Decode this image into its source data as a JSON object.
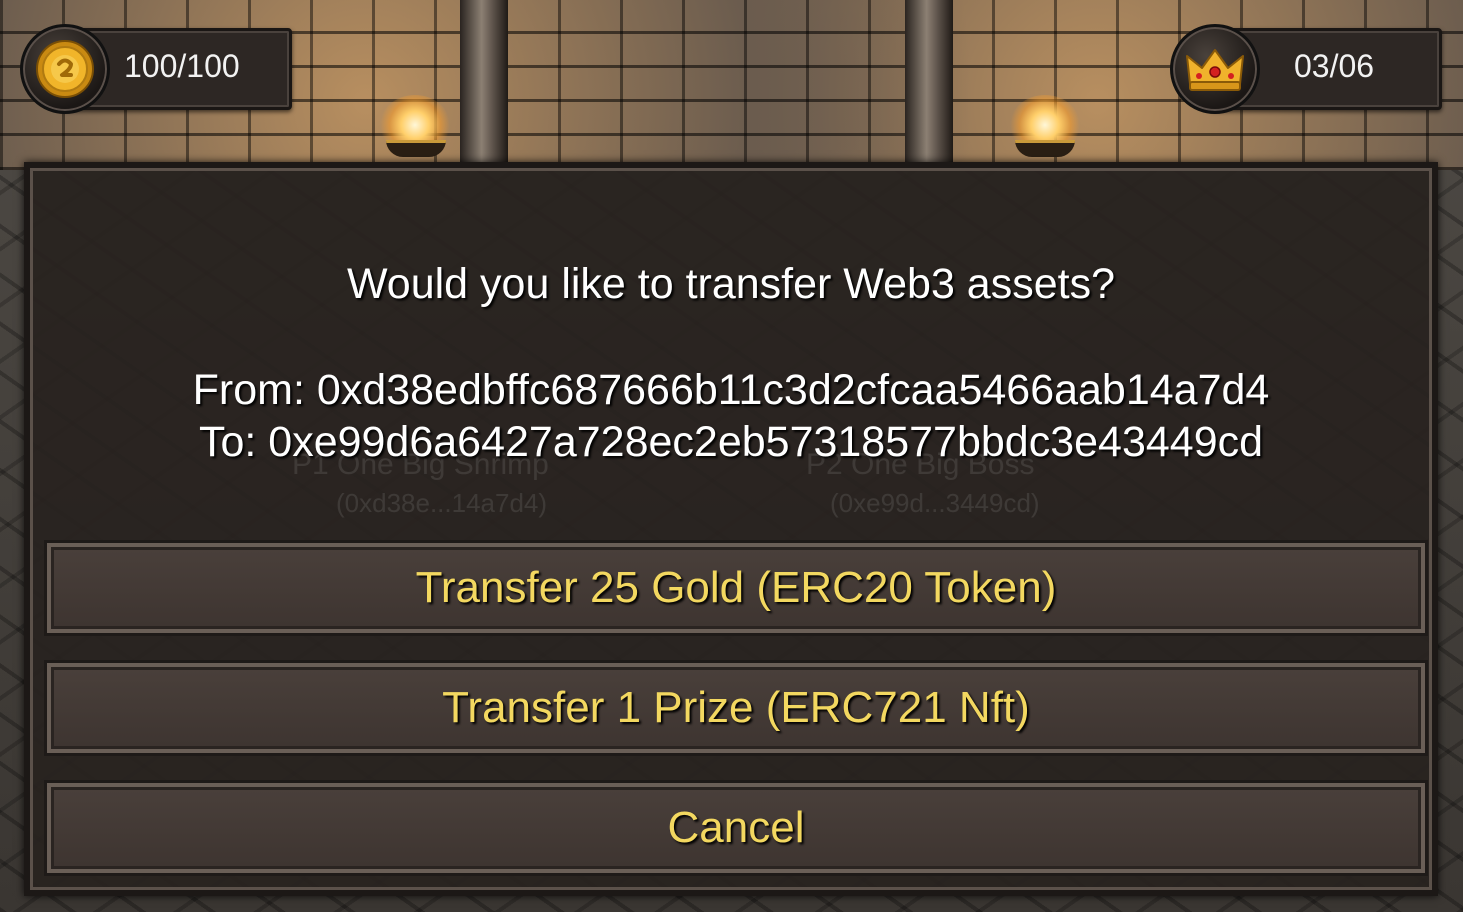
{
  "hud": {
    "gold": {
      "icon": "gold-coin-icon",
      "value": "100/100"
    },
    "prizes": {
      "icon": "crown-icon",
      "value": "03/06"
    }
  },
  "dialog": {
    "title": "Would you like to transfer Web3 assets?",
    "from_line": "From: 0xd38edbffc687666b11c3d2cfcaa5466aab14a7d4",
    "to_line": "To: 0xe99d6a6427a728ec2eb57318577bbdc3e43449cd",
    "buttons": {
      "erc20": "Transfer 25 Gold (ERC20 Token)",
      "erc721": "Transfer 1 Prize (ERC721 Nft)",
      "cancel": "Cancel"
    }
  },
  "background": {
    "player1_name": "P1 One Big Shrimp",
    "player1_address": "(0xd38e...14a7d4)",
    "player2_name": "P2 One Big Boss",
    "player2_address": "(0xe99d...3449cd)"
  },
  "colors": {
    "button_text": "#f3d860",
    "dialog_bg": "#28221f",
    "text": "#ffffff"
  }
}
